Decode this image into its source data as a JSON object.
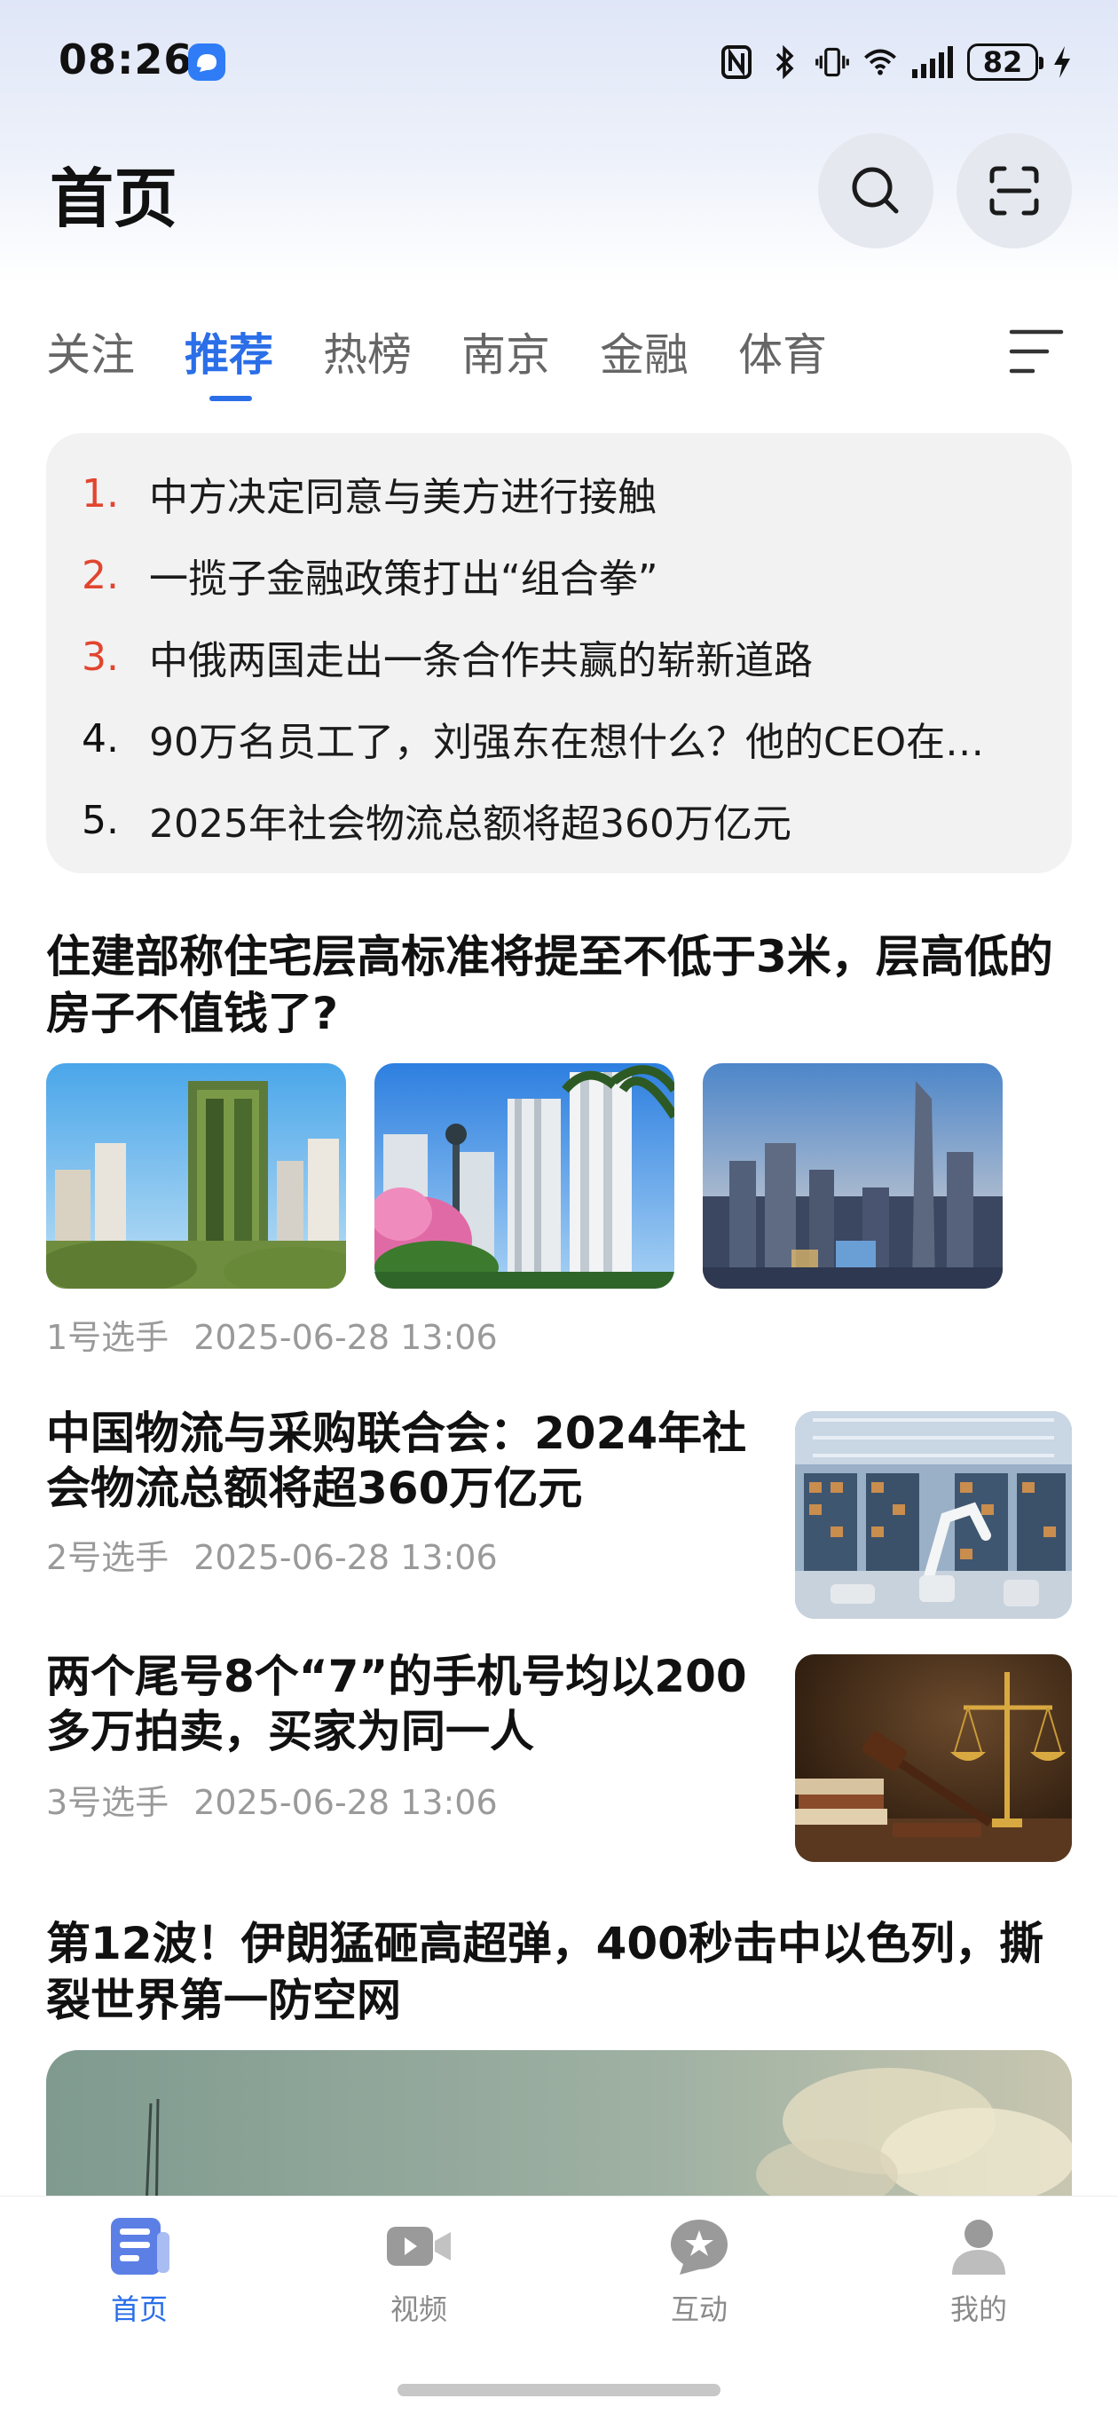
{
  "status_bar": {
    "time": "08:26",
    "battery": "82",
    "icons": [
      "nfc-icon",
      "bluetooth-icon",
      "vibrate-icon",
      "wifi-icon",
      "signal-icon",
      "battery-icon",
      "charging-icon"
    ]
  },
  "header": {
    "title": "首页",
    "search_icon": "search-icon",
    "scan_icon": "scan-icon"
  },
  "tabs": [
    {
      "label": "关注",
      "active": false
    },
    {
      "label": "推荐",
      "active": true
    },
    {
      "label": "热榜",
      "active": false
    },
    {
      "label": "南京",
      "active": false
    },
    {
      "label": "金融",
      "active": false
    },
    {
      "label": "体育",
      "active": false
    }
  ],
  "hot_list": [
    {
      "rank": "1.",
      "text": "中方决定同意与美方进行接触"
    },
    {
      "rank": "2.",
      "text": "一揽子金融政策打出“组合拳”"
    },
    {
      "rank": "3.",
      "text": "中俄两国走出一条合作共赢的崭新道路"
    },
    {
      "rank": "4.",
      "text": "90万名员工了，刘强东在想什么？他的CEO在…"
    },
    {
      "rank": "5.",
      "text": "2025年社会物流总额将超360万亿元"
    }
  ],
  "articles": [
    {
      "title": "住建部称住宅层高标准将提至不低于3米，层高低的房子不值钱了?",
      "source": "1号选手",
      "time": "2025-06-28 13:06"
    },
    {
      "title": "中国物流与采购联合会：2024年社会物流总额将超360万亿元",
      "source": "2号选手",
      "time": "2025-06-28 13:06"
    },
    {
      "title": "两个尾号8个“7”的手机号均以200多万拍卖，买家为同一人",
      "source": "3号选手",
      "time": "2025-06-28 13:06"
    },
    {
      "title": "第12波！伊朗猛砸高超弹，400秒击中以色列，撕裂世界第一防空网"
    }
  ],
  "bottom_nav": [
    {
      "label": "首页",
      "icon": "news-icon",
      "active": true
    },
    {
      "label": "视频",
      "icon": "video-icon",
      "active": false
    },
    {
      "label": "互动",
      "icon": "star-chat-icon",
      "active": false
    },
    {
      "label": "我的",
      "icon": "person-icon",
      "active": false
    }
  ],
  "colors": {
    "accent": "#2a6ee8",
    "hot_rank": "#e2452f"
  }
}
